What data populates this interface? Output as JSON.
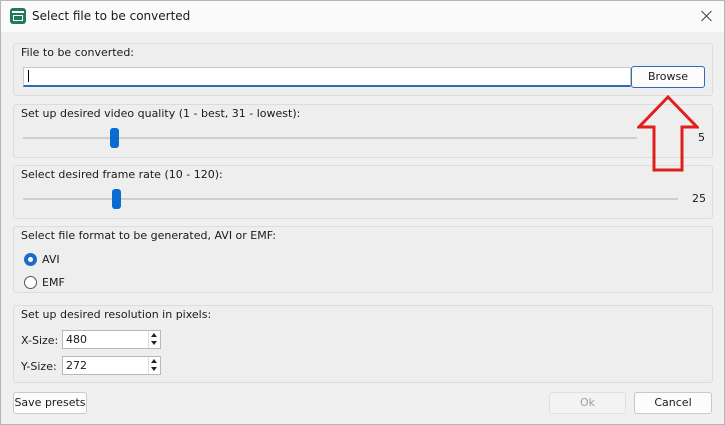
{
  "window": {
    "title": "Select file to be converted"
  },
  "file_group": {
    "label": "File to be converted:",
    "input_value": "",
    "browse_label": "Browse"
  },
  "quality_group": {
    "label": "Set up desired video quality (1 - best, 31 - lowest):",
    "value": "5"
  },
  "framerate_group": {
    "label": "Select desired frame rate (10 - 120):",
    "value": "25"
  },
  "format_group": {
    "label": "Select file format to be generated, AVI or EMF:",
    "options": [
      {
        "label": "AVI",
        "selected": true
      },
      {
        "label": "EMF",
        "selected": false
      }
    ]
  },
  "resolution_group": {
    "label": "Set up desired resolution in pixels:",
    "x_label": "X-Size:",
    "x_value": "480",
    "y_label": "Y-Size:",
    "y_value": "272"
  },
  "footer": {
    "save_presets_label": "Save presets",
    "ok_label": "Ok",
    "cancel_label": "Cancel"
  },
  "annotation": {
    "arrow_color": "#e0201c",
    "icon": "arrow-up-icon"
  },
  "colors": {
    "accent": "#0a6cd1"
  }
}
